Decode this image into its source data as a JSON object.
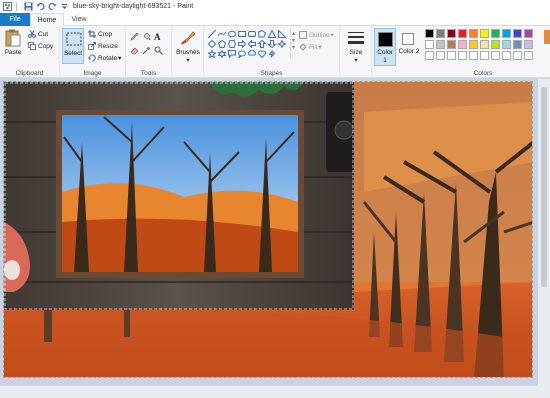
{
  "window": {
    "title": "blue-sky-bright-daylight-693521 - Paint"
  },
  "tabs": [
    {
      "label": "File"
    },
    {
      "label": "Home"
    },
    {
      "label": "View"
    }
  ],
  "clipboard": {
    "label": "Clipboard",
    "paste": "Paste",
    "cut": "Cut",
    "copy": "Copy"
  },
  "image": {
    "label": "Image",
    "select": "Select",
    "crop": "Crop",
    "resize": "Resize",
    "rotate": "Rotate"
  },
  "tools": {
    "label": "Tools"
  },
  "brushes": {
    "label": "Brushes"
  },
  "shapes": {
    "label": "Shapes",
    "outline": "Outline",
    "fill": "Fill"
  },
  "size": {
    "label": "Size"
  },
  "color1": {
    "label": "Color 1",
    "value": "#000000"
  },
  "color2": {
    "label": "Color 2",
    "value": "#ffffff"
  },
  "colors": {
    "label": "Colors",
    "palette": [
      "#000000",
      "#7f7f7f",
      "#880015",
      "#ed1c24",
      "#ff7f27",
      "#fff200",
      "#22b14c",
      "#00a2e8",
      "#3f48cc",
      "#a349a4",
      "#ffffff",
      "#c3c3c3",
      "#b97a57",
      "#ffaec9",
      "#ffc90e",
      "#efe4b0",
      "#b5e61d",
      "#99d9ea",
      "#7092be",
      "#c8bfe7",
      "#ffffff",
      "#ffffff",
      "#ffffff",
      "#ffffff",
      "#ffffff",
      "#ffffff",
      "#ffffff",
      "#ffffff",
      "#ffffff",
      "#ffffff"
    ]
  }
}
